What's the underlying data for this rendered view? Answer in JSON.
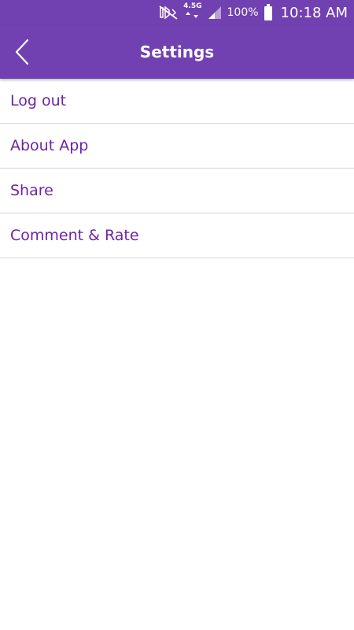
{
  "status_bar": {
    "network_label": "4.5G",
    "battery": "100%",
    "time": "10:18 AM",
    "icons": [
      "mute-icon",
      "network-arrows-icon",
      "signal-icon",
      "battery-icon"
    ]
  },
  "app_bar": {
    "title": "Settings",
    "back_icon": "chevron-left-icon",
    "color": "#7140b1"
  },
  "menu": {
    "item_color": "#6e22a8",
    "items": [
      {
        "label": "Log out"
      },
      {
        "label": "About App"
      },
      {
        "label": "Share"
      },
      {
        "label": "Comment & Rate"
      }
    ]
  }
}
